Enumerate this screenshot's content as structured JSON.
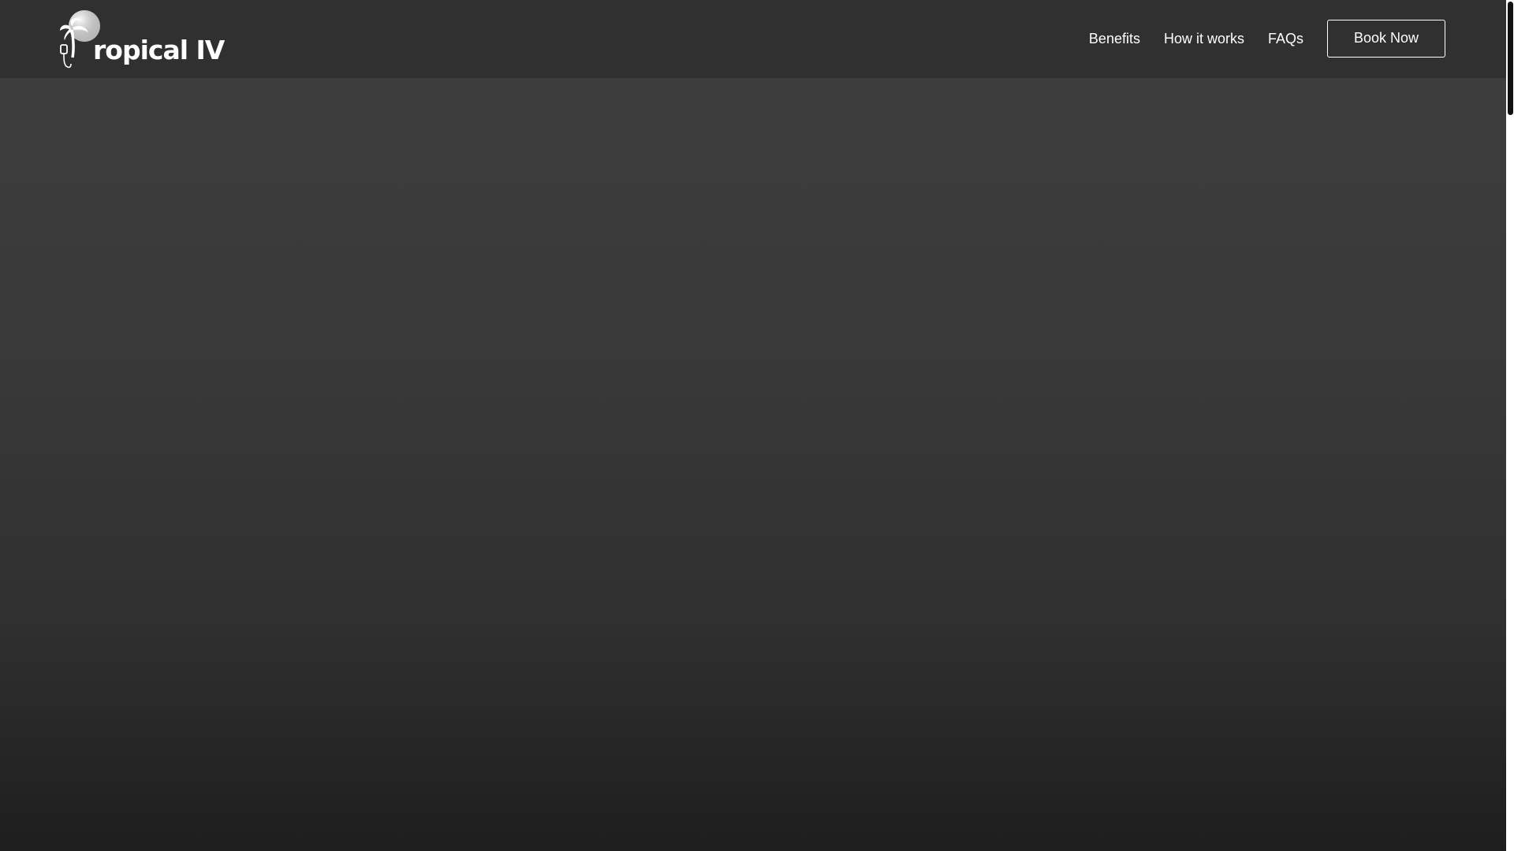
{
  "brand": {
    "name": "ropical IV",
    "logo_icon": "palm-tree-sun-iv-icon"
  },
  "nav": {
    "items": [
      {
        "label": "Benefits"
      },
      {
        "label": "How it works"
      },
      {
        "label": "FAQs"
      }
    ],
    "cta_label": "Book Now"
  },
  "colors": {
    "header_bg": "#303030",
    "hero_top": "#3d3d3d",
    "hero_bottom": "#1e1e1e",
    "text": "#ffffff"
  }
}
